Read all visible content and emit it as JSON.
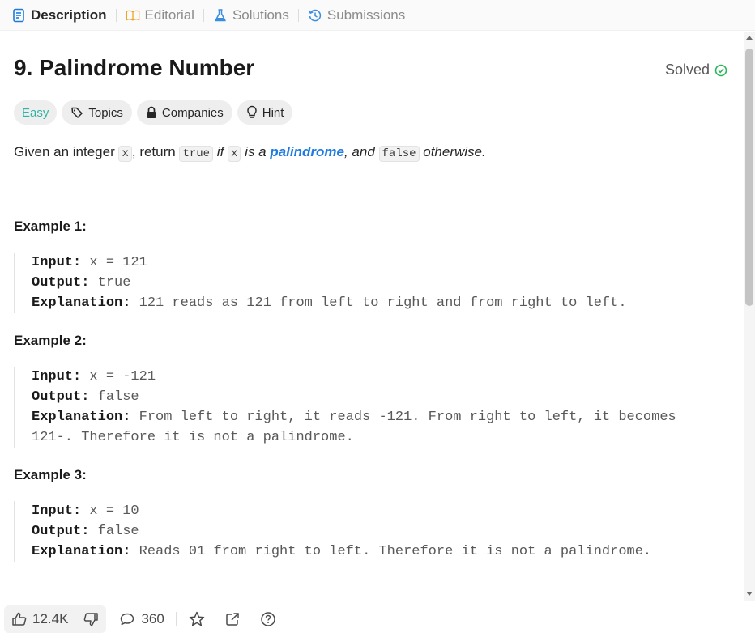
{
  "tabs": [
    {
      "label": "Description",
      "icon": "description-icon"
    },
    {
      "label": "Editorial",
      "icon": "book-icon"
    },
    {
      "label": "Solutions",
      "icon": "flask-icon"
    },
    {
      "label": "Submissions",
      "icon": "history-icon"
    }
  ],
  "problem": {
    "title": "9. Palindrome Number",
    "status": "Solved",
    "tags": {
      "difficulty": "Easy",
      "topics": "Topics",
      "companies": "Companies",
      "hint": "Hint"
    },
    "description": {
      "p1": "Given an integer ",
      "c1": "x",
      "p2": ", return ",
      "c2": "true",
      "p3": " if ",
      "c3": "x",
      "p4": " is a ",
      "link": "palindrome",
      "p5": ", and ",
      "c4": "false",
      "p6": " otherwise."
    }
  },
  "examples": [
    {
      "title": "Example 1:",
      "input_label": "Input:",
      "input": " x = 121",
      "output_label": "Output:",
      "output": " true",
      "expl_label": "Explanation:",
      "expl1": " 121 reads as 121 from left to right and from right to left.",
      "expl2": ""
    },
    {
      "title": "Example 2:",
      "input_label": "Input:",
      "input": " x = -121",
      "output_label": "Output:",
      "output": " false",
      "expl_label": "Explanation:",
      "expl1": " From left to right, it reads -121. From right to left, it becomes",
      "expl2": "121-. Therefore it is not a palindrome."
    },
    {
      "title": "Example 3:",
      "input_label": "Input:",
      "input": " x = 10",
      "output_label": "Output:",
      "output": " false",
      "expl_label": "Explanation:",
      "expl1": " Reads 01 from right to left. Therefore it is not a palindrome.",
      "expl2": ""
    }
  ],
  "footer": {
    "likes": "12.4K",
    "comments": "360"
  },
  "colors": {
    "accent": "#1e7be0",
    "easy": "#2fb5a6",
    "solved": "#2db55d"
  }
}
